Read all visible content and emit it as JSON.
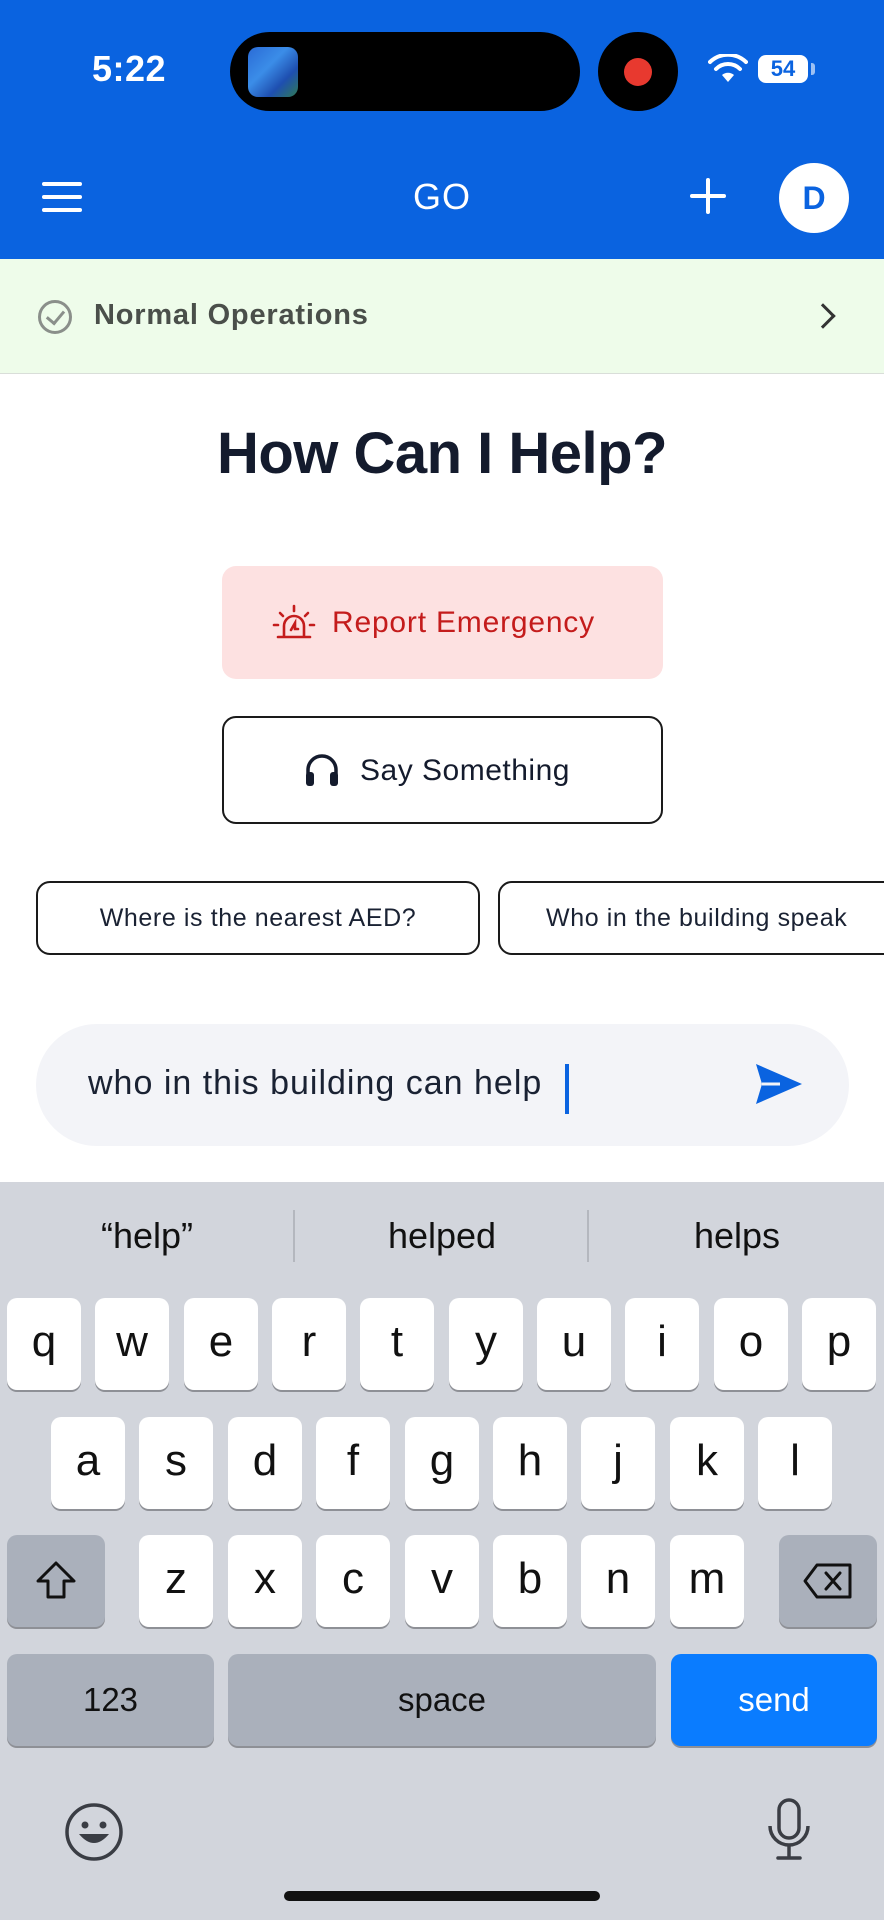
{
  "status_bar": {
    "time": "5:22",
    "battery": "54"
  },
  "app_bar": {
    "title": "GO",
    "avatar_initial": "D"
  },
  "banner": {
    "text": "Normal Operations"
  },
  "main": {
    "heading": "How Can I Help?",
    "emergency_label": "Report Emergency",
    "say_label": "Say Something",
    "chips": [
      "Where is the nearest AED?",
      "Who in the building speak"
    ]
  },
  "input": {
    "value": "who in this building can help"
  },
  "keyboard": {
    "suggestions": [
      "“help”",
      "helped",
      "helps"
    ],
    "row1": [
      "q",
      "w",
      "e",
      "r",
      "t",
      "y",
      "u",
      "i",
      "o",
      "p"
    ],
    "row2": [
      "a",
      "s",
      "d",
      "f",
      "g",
      "h",
      "j",
      "k",
      "l"
    ],
    "row3": [
      "z",
      "x",
      "c",
      "v",
      "b",
      "n",
      "m"
    ],
    "numbers_label": "123",
    "space_label": "space",
    "send_label": "send"
  },
  "colors": {
    "brand": "#0a63e0",
    "emergency": "#c41c1c",
    "banner_bg": "#eefcea",
    "send_key": "#0a7cff"
  }
}
